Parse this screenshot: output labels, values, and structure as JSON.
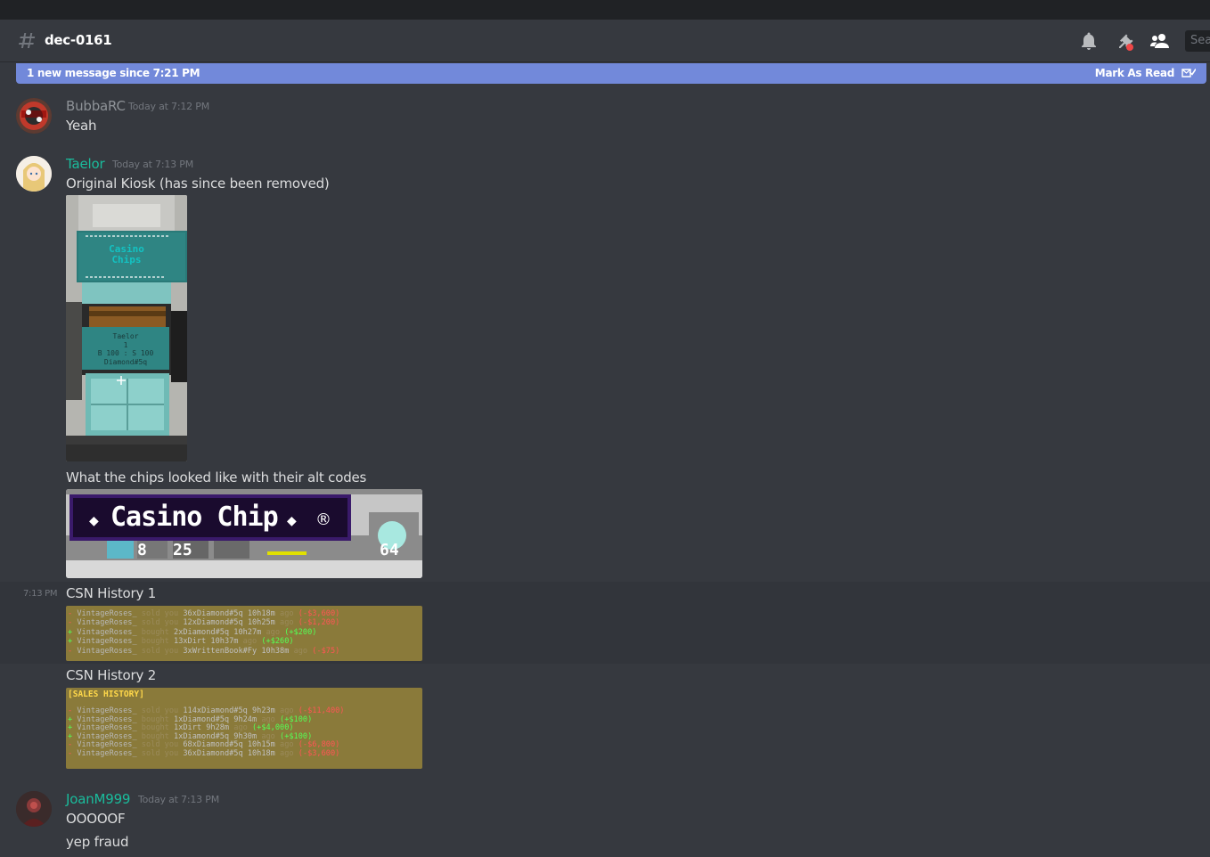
{
  "header": {
    "channel_name": "dec-0161",
    "search_placeholder": "Search"
  },
  "new_messages_bar": {
    "text": "1 new message since 7:21 PM",
    "mark_as_read": "Mark As Read"
  },
  "messages": [
    {
      "username": "BubbaRC",
      "username_color": "#8e9297",
      "timestamp": "Today at 7:12 PM",
      "text": "Yeah"
    },
    {
      "username": "Taelor",
      "username_color": "#1abc9c",
      "timestamp": "Today at 7:13 PM",
      "text": "Original Kiosk (has since been removed)",
      "text2": "What the chips looked like with their alt codes",
      "kiosk_sign_title_1": "Casino",
      "kiosk_sign_title_2": "Chips",
      "kiosk_sign_lower_1": "Taelor",
      "kiosk_sign_lower_2": "1",
      "kiosk_sign_lower_3": "B 100 : S 100",
      "kiosk_sign_lower_4": "Diamond#5q",
      "chip_tooltip": "Casino Chip",
      "chip_count_1": "8",
      "chip_count_2": "25",
      "chip_count_3": "64"
    },
    {
      "side_timestamp": "7:13 PM",
      "text": "CSN History 1",
      "history_lines": [
        {
          "player": "VintageRoses_",
          "action": "sold you",
          "item": "36xDiamond#5q",
          "time": "10h18m",
          "ago": "ago",
          "amount": "(-$3,600)",
          "sign": "-"
        },
        {
          "player": "VintageRoses_",
          "action": "sold you",
          "item": "12xDiamond#5q",
          "time": "10h25m",
          "ago": "ago",
          "amount": "(-$1,200)",
          "sign": "-"
        },
        {
          "player": "VintageRoses_",
          "action": "bought",
          "item": "2xDiamond#5q",
          "time": "10h27m",
          "ago": "ago",
          "amount": "(+$200)",
          "sign": "+"
        },
        {
          "player": "VintageRoses_",
          "action": "bought",
          "item": "13xDirt",
          "time": "10h37m",
          "ago": "ago",
          "amount": "(+$260)",
          "sign": "+"
        },
        {
          "player": "VintageRoses_",
          "action": "sold you",
          "item": "3xWrittenBook#Fy",
          "time": "10h38m",
          "ago": "ago",
          "amount": "(-$75)",
          "sign": "-"
        }
      ]
    },
    {
      "text": "CSN History 2",
      "history_title": "[SALES HISTORY]",
      "history_lines": [
        {
          "player": "VintageRoses_",
          "action": "sold you",
          "item": "114xDiamond#5q",
          "time": "9h23m",
          "ago": "ago",
          "amount": "(-$11,400)",
          "sign": "-"
        },
        {
          "player": "VintageRoses_",
          "action": "bought",
          "item": "1xDiamond#5q",
          "time": "9h24m",
          "ago": "ago",
          "amount": "(+$100)",
          "sign": "+"
        },
        {
          "player": "VintageRoses_",
          "action": "bought",
          "item": "1xDirt",
          "time": "9h28m",
          "ago": "ago",
          "amount": "(+$4,000)",
          "sign": "+"
        },
        {
          "player": "VintageRoses_",
          "action": "bought",
          "item": "1xDiamond#5q",
          "time": "9h30m",
          "ago": "ago",
          "amount": "(+$100)",
          "sign": "+"
        },
        {
          "player": "VintageRoses_",
          "action": "sold you",
          "item": "68xDiamond#5q",
          "time": "10h15m",
          "ago": "ago",
          "amount": "(-$6,800)",
          "sign": "-"
        },
        {
          "player": "VintageRoses_",
          "action": "sold you",
          "item": "36xDiamond#5q",
          "time": "10h18m",
          "ago": "ago",
          "amount": "(-$3,600)",
          "sign": "-"
        }
      ]
    },
    {
      "username": "JoanM999",
      "username_color": "#1abc9c",
      "timestamp": "Today at 7:13 PM",
      "text": "OOOOOF",
      "text2": "yep fraud"
    }
  ]
}
